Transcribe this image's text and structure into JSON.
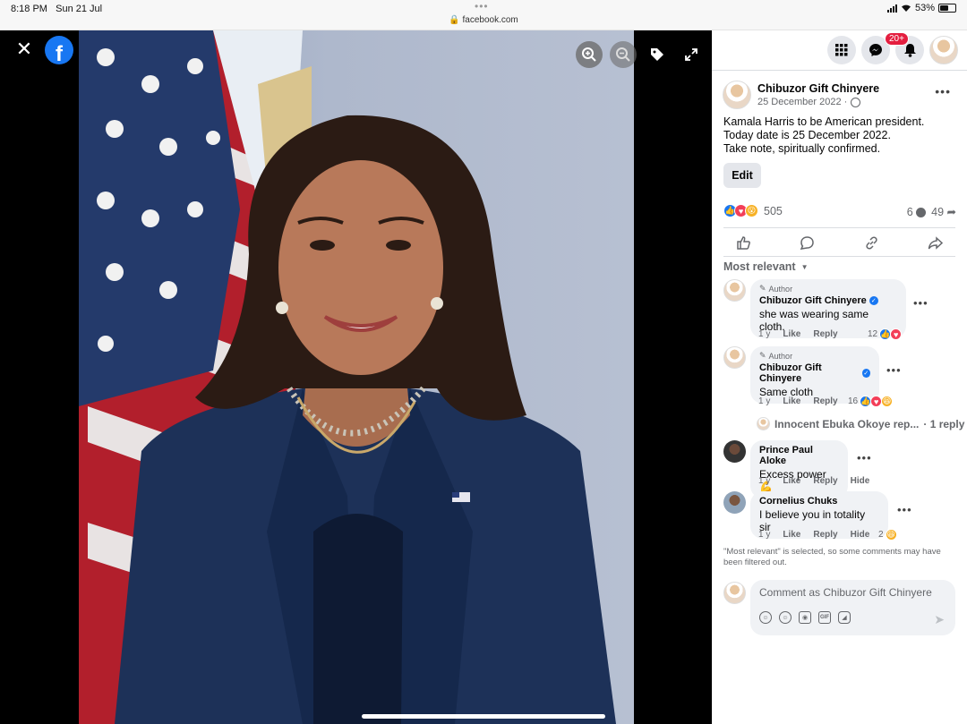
{
  "status_bar": {
    "time": "8:18 PM",
    "date": "Sun 21 Jul",
    "url": "facebook.com",
    "battery": "53%"
  },
  "viewer": {
    "close_icon": "close-icon",
    "logo": "f",
    "tools": [
      "zoom-in-icon",
      "zoom-out-icon",
      "tag-icon",
      "fullscreen-icon"
    ]
  },
  "header": {
    "notifications_badge": "20+",
    "icons": [
      "menu-grid-icon",
      "messenger-icon",
      "bell-icon",
      "profile-avatar"
    ]
  },
  "post": {
    "author": "Chibuzor Gift Chinyere",
    "date": "25 December 2022 ·",
    "text_lines": [
      "Kamala Harris to be American president.",
      "Today date is 25 December 2022.",
      "Take note, spiritually confirmed."
    ],
    "edit_label": "Edit",
    "reaction_count": "505",
    "comment_count": "6",
    "share_count": "49"
  },
  "sort_label": "Most relevant",
  "comments": [
    {
      "author_tag": "Author",
      "name": "Chibuzor Gift Chinyere",
      "text": "she was wearing same cloth.",
      "time": "1 y",
      "like": "Like",
      "reply": "Reply",
      "reactions": "12"
    },
    {
      "author_tag": "Author",
      "name": "Chibuzor Gift Chinyere",
      "text": "Same cloth",
      "time": "1 y",
      "like": "Like",
      "reply": "Reply",
      "reactions": "16"
    },
    {
      "name": "Prince Paul Aloke",
      "text": "Excess power 💪",
      "time": "1 y",
      "like": "Like",
      "reply": "Reply",
      "hide": "Hide"
    },
    {
      "name": "Cornelius Chuks",
      "text": "I believe you in totality sir",
      "time": "1 y",
      "like": "Like",
      "reply": "Reply",
      "hide": "Hide",
      "reactions": "2"
    }
  ],
  "replies_link": {
    "name": "Innocent Ebuka Okoye rep...",
    "count": "· 1 reply"
  },
  "filter_note": "\"Most relevant\" is selected, so some comments may have been filtered out.",
  "composer": {
    "placeholder": "Comment as Chibuzor Gift Chinyere"
  },
  "colors": {
    "facebook_blue": "#1877f2",
    "badge_red": "#e41e3f",
    "bubble_gray": "#f0f2f5"
  }
}
